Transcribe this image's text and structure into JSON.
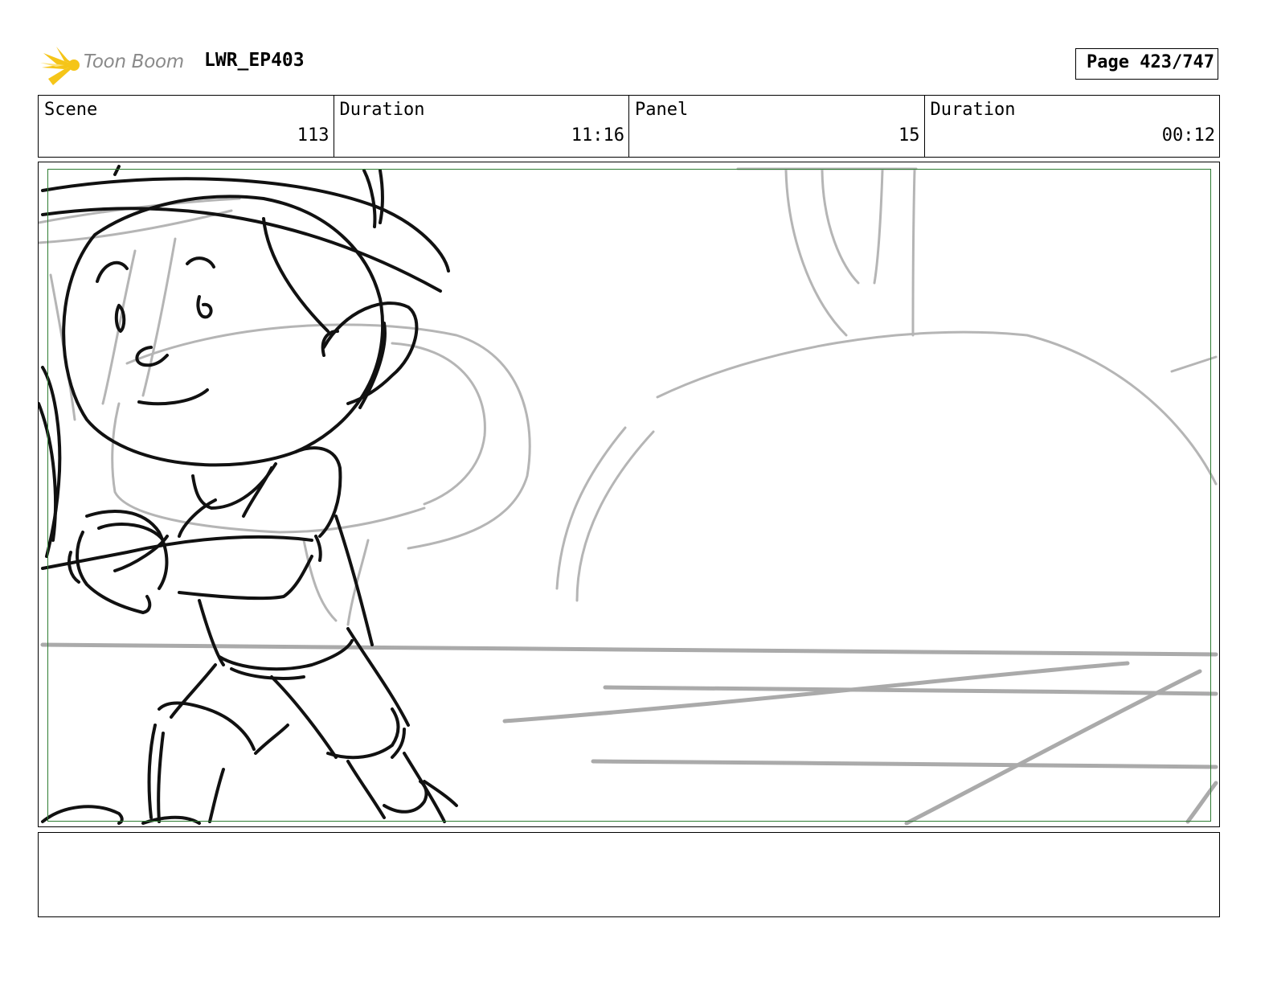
{
  "header": {
    "logo_text": "Toon Boom",
    "project": "LWR_EP403",
    "page_label": "Page 423/747"
  },
  "info": {
    "scene_label": "Scene",
    "scene_value": "113",
    "scene_duration_label": "Duration",
    "scene_duration_value": "11:16",
    "panel_label": "Panel",
    "panel_value": "15",
    "panel_duration_label": "Duration",
    "panel_duration_value": "00:12"
  },
  "colors": {
    "safe_frame": "#2e7d32",
    "sketch_dark": "#111111",
    "sketch_light": "#b5b5b5",
    "logo_yellow": "#f5c518"
  },
  "notes": {
    "text": ""
  }
}
